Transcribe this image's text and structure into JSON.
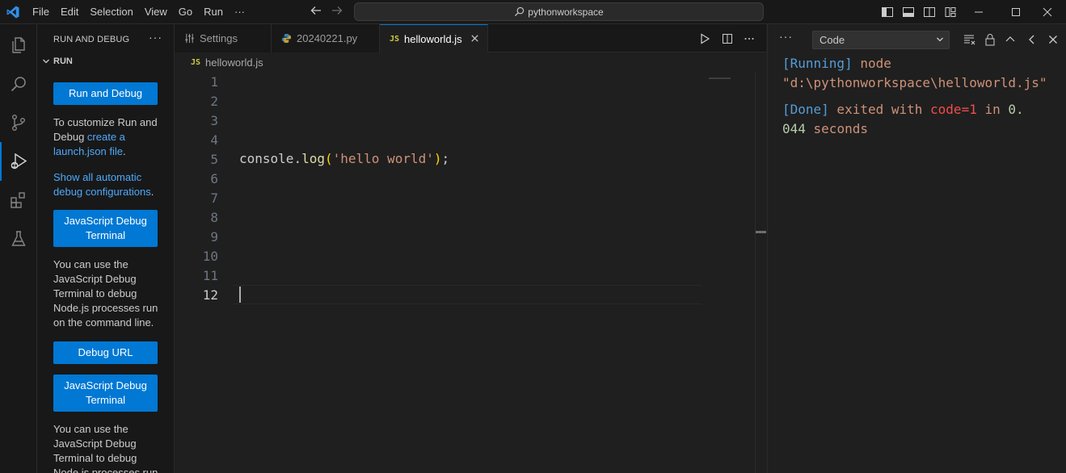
{
  "titlebar": {
    "menu": [
      "File",
      "Edit",
      "Selection",
      "View",
      "Go",
      "Run",
      "···"
    ],
    "search_text": "pythonworkspace"
  },
  "sidebar": {
    "header": "RUN AND DEBUG",
    "more": "···",
    "section": "RUN",
    "run_debug_button": "Run and Debug",
    "customize_text_1": "To customize Run and Debug ",
    "customize_link": "create a launch.json file",
    "customize_text_2": ".",
    "show_all_link": "Show all automatic debug configurations",
    "show_all_text": ".",
    "js_debug_button_1": "JavaScript Debug Terminal",
    "js_debug_desc_1": "You can use the JavaScript Debug Terminal to debug Node.js processes run on the command line.",
    "debug_url_button": "Debug URL",
    "js_debug_button_2": "JavaScript Debug Terminal",
    "js_debug_desc_2": "You can use the JavaScript Debug Terminal to debug Node.js processes run on the command line."
  },
  "editor": {
    "tabs": [
      {
        "label": "Settings",
        "icon": "settings-icon"
      },
      {
        "label": "20240221.py",
        "icon": "python-icon"
      },
      {
        "label": "helloworld.js",
        "icon": "js-icon",
        "active": true
      }
    ],
    "js_badge": "JS",
    "breadcrumb": "helloworld.js",
    "line_numbers": [
      "1",
      "2",
      "3",
      "4",
      "5",
      "6",
      "7",
      "8",
      "9",
      "10",
      "11",
      "12"
    ],
    "code": {
      "obj": "console",
      "dot": ".",
      "method": "log",
      "open": "(",
      "string": "'hello world'",
      "close": ")",
      "semi": ";"
    }
  },
  "panel": {
    "more": "···",
    "select_value": "Code",
    "output": {
      "running_tag": "[Running]",
      "running_cmd": " node",
      "running_path": "\"d:\\pythonworkspace\\helloworld.js\"",
      "done_tag": "[Done]",
      "exited_with": " exited with ",
      "code": "code=1",
      "in_word": " in ",
      "time_int": "0.",
      "time_frac": "044",
      "seconds": " seconds"
    }
  },
  "colors": {
    "accent": "#0078d4",
    "link": "#4daafc",
    "keyword_blue": "#569cd6",
    "string_orange": "#ce9178",
    "error_red": "#f14c4c",
    "number_green": "#b5cea8"
  }
}
